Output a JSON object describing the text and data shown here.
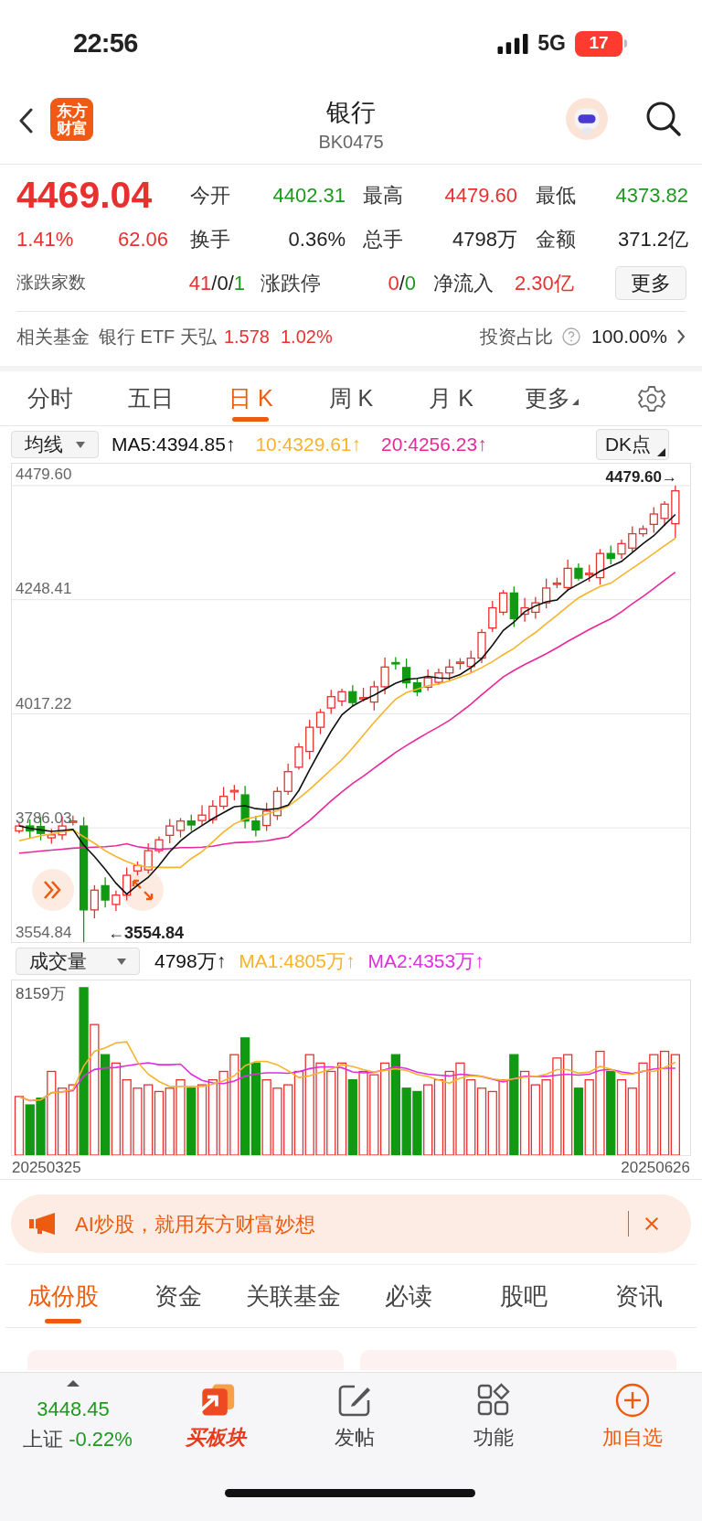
{
  "status_bar": {
    "time": "22:56",
    "network": "5G",
    "battery": "17"
  },
  "header": {
    "logo": [
      "东方",
      "财富"
    ],
    "title": "银行",
    "code": "BK0475"
  },
  "quote": {
    "price": "4469.04",
    "change_pct": "1.41%",
    "change": "62.06",
    "stats": [
      {
        "label": "今开",
        "value": "4402.31",
        "color": "#1d9a1d"
      },
      {
        "label": "最高",
        "value": "4479.60",
        "color": "#e8312e"
      },
      {
        "label": "最低",
        "value": "4373.82",
        "color": "#1d9a1d"
      },
      {
        "label": "换手",
        "value": "0.36%",
        "color": "#222222"
      },
      {
        "label": "总手",
        "value": "4798万",
        "color": "#222222"
      },
      {
        "label": "金额",
        "value": "371.2亿",
        "color": "#222222"
      }
    ],
    "breadth_label": "涨跌家数",
    "breadth": [
      {
        "text": "41",
        "color": "#e8312e"
      },
      {
        "text": "/0/",
        "color": "#222222"
      },
      {
        "text": "1",
        "color": "#1d9a1d"
      }
    ],
    "limit_label": "涨跌停",
    "limit": [
      {
        "text": "0",
        "color": "#e8312e"
      },
      {
        "text": "/",
        "color": "#222222"
      },
      {
        "text": "0",
        "color": "#1d9a1d"
      }
    ],
    "inflow_label": "净流入",
    "inflow": "2.30亿",
    "more_button": "更多"
  },
  "fund": {
    "label": "相关基金",
    "name": "银行 ETF 天弘",
    "price": "1.578",
    "pct": "1.02%",
    "ratio_label": "投资占比",
    "ratio": "100.00%"
  },
  "chart_tabs": [
    {
      "label": "分时",
      "selected": false
    },
    {
      "label": "五日",
      "selected": false
    },
    {
      "label": "日 K",
      "selected": true
    },
    {
      "label": "周 K",
      "selected": false
    },
    {
      "label": "月 K",
      "selected": false
    },
    {
      "label": "更多",
      "selected": false,
      "dropdown": true
    }
  ],
  "indicator": {
    "selector": "均线",
    "ma": [
      {
        "text": "MA5:4394.85↑",
        "color": "#111111"
      },
      {
        "text": "10:4329.61↑",
        "color": "#f7b32b"
      },
      {
        "text": "20:4256.23↑",
        "color": "#e8289a"
      }
    ],
    "dk_button": "DK点"
  },
  "price_chart": {
    "high_marker": "4479.60→",
    "low_marker": "←3554.84",
    "chart_data": {
      "type": "candlestick",
      "ylim": [
        3554.84,
        4479.6
      ],
      "grid": true,
      "ohlc": [
        [
          3780,
          3796,
          3775,
          3790
        ],
        [
          3790,
          3803,
          3764,
          3780
        ],
        [
          3789,
          3809,
          3761,
          3775
        ],
        [
          3766,
          3784,
          3754,
          3772
        ],
        [
          3772,
          3809,
          3762,
          3790
        ],
        [
          3799,
          3811,
          3791,
          3800
        ],
        [
          3790,
          3808,
          3554.84,
          3620
        ],
        [
          3620,
          3670,
          3603,
          3660
        ],
        [
          3669,
          3686,
          3625,
          3640
        ],
        [
          3631,
          3659,
          3618,
          3650
        ],
        [
          3650,
          3706,
          3639,
          3690
        ],
        [
          3699,
          3718,
          3690,
          3710
        ],
        [
          3701,
          3755,
          3694,
          3740
        ],
        [
          3740,
          3769,
          3735,
          3762
        ],
        [
          3771,
          3804,
          3755,
          3790
        ],
        [
          3781,
          3806,
          3767,
          3800
        ],
        [
          3800,
          3813,
          3780,
          3792
        ],
        [
          3801,
          3832,
          3791,
          3812
        ],
        [
          3803,
          3842,
          3795,
          3830
        ],
        [
          3830,
          3869,
          3824,
          3850
        ],
        [
          3859,
          3873,
          3842,
          3862
        ],
        [
          3853,
          3871,
          3785,
          3800
        ],
        [
          3800,
          3810,
          3769,
          3782
        ],
        [
          3791,
          3837,
          3780,
          3820
        ],
        [
          3811,
          3869,
          3802,
          3860
        ],
        [
          3860,
          3916,
          3853,
          3900
        ],
        [
          3909,
          3958,
          3904,
          3950
        ],
        [
          3941,
          4005,
          3925,
          3990
        ],
        [
          3990,
          4027,
          3976,
          4020
        ],
        [
          4029,
          4066,
          4017,
          4052
        ],
        [
          4043,
          4068,
          4033,
          4062
        ],
        [
          4062,
          4075,
          4032,
          4040
        ],
        [
          4049,
          4070,
          4043,
          4050
        ],
        [
          4041,
          4084,
          4024,
          4072
        ],
        [
          4072,
          4131,
          4057,
          4112
        ],
        [
          4121,
          4132,
          4107,
          4120
        ],
        [
          4111,
          4129,
          4069,
          4080
        ],
        [
          4080,
          4090,
          4053,
          4062
        ],
        [
          4071,
          4107,
          4064,
          4090
        ],
        [
          4081,
          4109,
          4076,
          4100
        ],
        [
          4100,
          4128,
          4084,
          4112
        ],
        [
          4121,
          4130,
          4107,
          4122
        ],
        [
          4113,
          4145,
          4101,
          4130
        ],
        [
          4130,
          4189,
          4120,
          4182
        ],
        [
          4191,
          4246,
          4183,
          4232
        ],
        [
          4223,
          4268,
          4217,
          4262
        ],
        [
          4262,
          4275,
          4193,
          4210
        ],
        [
          4219,
          4252,
          4204,
          4232
        ],
        [
          4223,
          4254,
          4210,
          4242
        ],
        [
          4242,
          4291,
          4231,
          4272
        ],
        [
          4281,
          4293,
          4272,
          4282
        ],
        [
          4273,
          4330,
          4266,
          4312
        ],
        [
          4312,
          4322,
          4287,
          4292
        ],
        [
          4301,
          4319,
          4285,
          4302
        ],
        [
          4293,
          4351,
          4279,
          4342
        ],
        [
          4342,
          4358,
          4320,
          4332
        ],
        [
          4341,
          4370,
          4331,
          4362
        ],
        [
          4353,
          4397,
          4345,
          4382
        ],
        [
          4382,
          4399,
          4376,
          4392
        ],
        [
          4401,
          4436,
          4384,
          4422
        ],
        [
          4413,
          4448,
          4398,
          4442
        ],
        [
          4402.31,
          4479.6,
          4373.82,
          4469.04
        ]
      ],
      "yticks": [
        {
          "value": 4479.6,
          "label": "4479.60"
        },
        {
          "value": 4248.41,
          "label": "4248.41"
        },
        {
          "value": 4017.22,
          "label": "4017.22"
        },
        {
          "value": 3786.03,
          "label": "3786.03"
        },
        {
          "value": 3554.84,
          "label": "3554.84"
        }
      ],
      "series": [
        {
          "type": "line",
          "color": "#e8289a",
          "values": [
            3735,
            3737,
            3739,
            3741,
            3743,
            3745,
            3746,
            3747,
            3748,
            3750,
            3754,
            3748,
            3745,
            3743,
            3744,
            3746,
            3746,
            3747,
            3749,
            3753,
            3756,
            3757,
            3758,
            3760,
            3764,
            3768,
            3785,
            3801,
            3821,
            3841,
            3859,
            3876,
            3891,
            3907,
            3923,
            3939,
            3953,
            3966,
            3979,
            3991,
            4004,
            4020,
            4037,
            4056,
            4074,
            4092,
            4105,
            4117,
            4128,
            4139,
            4151,
            4164,
            4176,
            4188,
            4199,
            4210,
            4224,
            4240,
            4255,
            4271,
            4288,
            4304
          ]
        },
        {
          "type": "line",
          "color": "#f7b32b",
          "values": [
            3760,
            3765,
            3770,
            3774,
            3778,
            3782,
            3768,
            3755,
            3740,
            3728,
            3718,
            3710,
            3707,
            3706,
            3706,
            3706,
            3724,
            3738,
            3758,
            3778,
            3794,
            3804,
            3808,
            3814,
            3821,
            3830,
            3846,
            3864,
            3884,
            3904,
            3924,
            3948,
            3974,
            4000,
            4024,
            4047,
            4060,
            4067,
            4074,
            4078,
            4084,
            4092,
            4100,
            4111,
            4123,
            4137,
            4150,
            4167,
            4182,
            4200,
            4217,
            4235,
            4252,
            4264,
            4275,
            4282,
            4297,
            4312,
            4327,
            4342,
            4358,
            4373
          ]
        },
        {
          "type": "line",
          "color": "#111111",
          "values": [
            3790,
            3785,
            3782,
            3779,
            3781,
            3783,
            3751,
            3728,
            3702,
            3674,
            3652,
            3670,
            3686,
            3710,
            3738,
            3760,
            3777,
            3791,
            3805,
            3817,
            3829,
            3831,
            3825,
            3823,
            3825,
            3832,
            3862,
            3904,
            3944,
            3982,
            4015,
            4033,
            4045,
            4055,
            4067,
            4079,
            4087,
            4089,
            4093,
            4090,
            4089,
            4097,
            4111,
            4129,
            4156,
            4186,
            4203,
            4224,
            4236,
            4244,
            4248,
            4268,
            4280,
            4292,
            4306,
            4316,
            4326,
            4344,
            4362,
            4378,
            4400,
            4421
          ]
        }
      ]
    }
  },
  "volume": {
    "selector": "成交量",
    "items": [
      {
        "text": "4798万↑",
        "color": "#111111"
      },
      {
        "text": "MA1:4805万↑",
        "color": "#f7b32b"
      },
      {
        "text": "MA2:4353万↑",
        "color": "#e02de0"
      }
    ],
    "y_label": "8159万",
    "start_date": "20250325",
    "end_date": "20250626"
  },
  "banner": {
    "text": "AI炒股，就用东方财富妙想"
  },
  "section_tabs": [
    {
      "label": "成份股",
      "selected": true
    },
    {
      "label": "资金",
      "selected": false
    },
    {
      "label": "关联基金",
      "selected": false
    },
    {
      "label": "必读",
      "selected": false
    },
    {
      "label": "股吧",
      "selected": false
    },
    {
      "label": "资讯",
      "selected": false
    }
  ],
  "bottom_nav": {
    "index": {
      "value": "3448.45",
      "name": "上证",
      "change": "-0.22%",
      "color": "#1d9a1d"
    },
    "items": [
      {
        "kind": "buy",
        "label": "买板块"
      },
      {
        "kind": "post",
        "label": "发帖"
      },
      {
        "kind": "menu",
        "label": "功能"
      },
      {
        "kind": "add",
        "label": "加自选"
      }
    ]
  }
}
